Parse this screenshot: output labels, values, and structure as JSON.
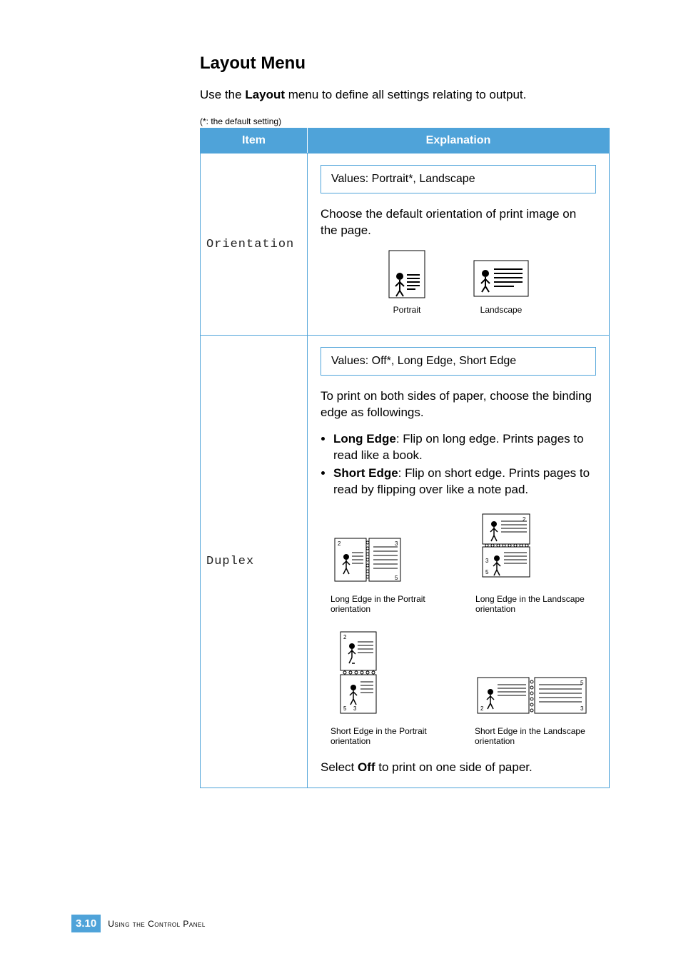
{
  "heading": "Layout Menu",
  "intro_prefix": "Use the ",
  "intro_bold": "Layout",
  "intro_suffix": " menu to define all settings relating to output.",
  "footnote": "(*: the default setting)",
  "table": {
    "headers": {
      "item": "Item",
      "explanation": "Explanation"
    },
    "rows": [
      {
        "item": "Orientation",
        "values": "Values: Portrait*, Landscape",
        "desc": "Choose the default orientation of print image on the page.",
        "illus": [
          {
            "caption": "Portrait"
          },
          {
            "caption": "Landscape"
          }
        ]
      },
      {
        "item": "Duplex",
        "values": "Values: Off*, Long Edge, Short Edge",
        "desc": "To print on both sides of paper, choose the binding edge as followings.",
        "bullets": [
          {
            "bold": "Long Edge",
            "text": ": Flip on long edge. Prints pages to read like a book."
          },
          {
            "bold": "Short Edge",
            "text": ": Flip on short edge. Prints pages to read by flipping over like a note pad."
          }
        ],
        "illus": [
          {
            "caption": "Long Edge in the Portrait orientation"
          },
          {
            "caption": "Long Edge in the Landscape orientation"
          },
          {
            "caption": "Short Edge in the Portrait orientation"
          },
          {
            "caption": "Short Edge in the Landscape orientation"
          }
        ],
        "select_prefix": "Select ",
        "select_bold": "Off",
        "select_suffix": " to print on one side of paper."
      }
    ]
  },
  "footer": {
    "chapter": "3.",
    "page": "10",
    "text": "Using the Control Panel"
  }
}
